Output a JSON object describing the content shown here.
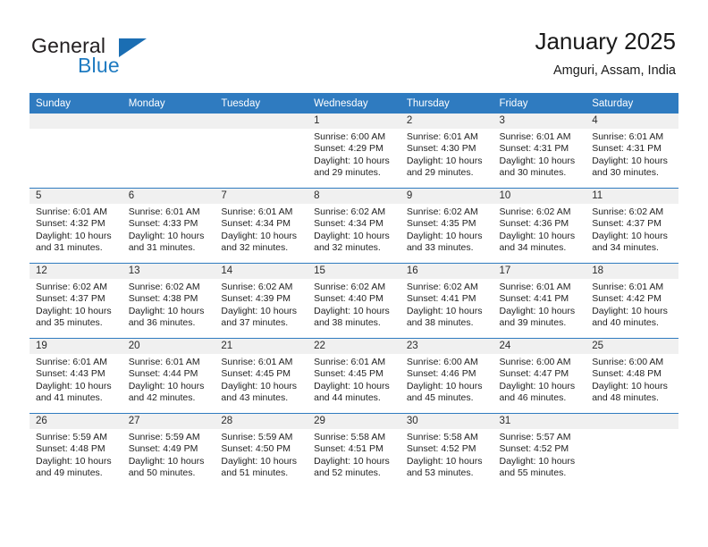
{
  "brand": {
    "name_part1": "General",
    "name_part2": "Blue",
    "triangle_color": "#1b6eb3",
    "blue_text_color": "#1f7bc1"
  },
  "header": {
    "title": "January 2025",
    "subtitle": "Amguri, Assam, India"
  },
  "theme": {
    "header_blue": "#2f7bc0",
    "daynum_band": "#f0f0f0",
    "cell_background": "#ffffff",
    "text_color": "#1f1f1f"
  },
  "weekdays": [
    "Sunday",
    "Monday",
    "Tuesday",
    "Wednesday",
    "Thursday",
    "Friday",
    "Saturday"
  ],
  "weeks": [
    [
      {
        "day": "",
        "sunrise": "",
        "sunset": "",
        "daylight_line1": "",
        "daylight_line2": "",
        "empty": true
      },
      {
        "day": "",
        "sunrise": "",
        "sunset": "",
        "daylight_line1": "",
        "daylight_line2": "",
        "empty": true
      },
      {
        "day": "",
        "sunrise": "",
        "sunset": "",
        "daylight_line1": "",
        "daylight_line2": "",
        "empty": true
      },
      {
        "day": "1",
        "sunrise": "Sunrise: 6:00 AM",
        "sunset": "Sunset: 4:29 PM",
        "daylight_line1": "Daylight: 10 hours",
        "daylight_line2": "and 29 minutes.",
        "empty": false
      },
      {
        "day": "2",
        "sunrise": "Sunrise: 6:01 AM",
        "sunset": "Sunset: 4:30 PM",
        "daylight_line1": "Daylight: 10 hours",
        "daylight_line2": "and 29 minutes.",
        "empty": false
      },
      {
        "day": "3",
        "sunrise": "Sunrise: 6:01 AM",
        "sunset": "Sunset: 4:31 PM",
        "daylight_line1": "Daylight: 10 hours",
        "daylight_line2": "and 30 minutes.",
        "empty": false
      },
      {
        "day": "4",
        "sunrise": "Sunrise: 6:01 AM",
        "sunset": "Sunset: 4:31 PM",
        "daylight_line1": "Daylight: 10 hours",
        "daylight_line2": "and 30 minutes.",
        "empty": false
      }
    ],
    [
      {
        "day": "5",
        "sunrise": "Sunrise: 6:01 AM",
        "sunset": "Sunset: 4:32 PM",
        "daylight_line1": "Daylight: 10 hours",
        "daylight_line2": "and 31 minutes.",
        "empty": false
      },
      {
        "day": "6",
        "sunrise": "Sunrise: 6:01 AM",
        "sunset": "Sunset: 4:33 PM",
        "daylight_line1": "Daylight: 10 hours",
        "daylight_line2": "and 31 minutes.",
        "empty": false
      },
      {
        "day": "7",
        "sunrise": "Sunrise: 6:01 AM",
        "sunset": "Sunset: 4:34 PM",
        "daylight_line1": "Daylight: 10 hours",
        "daylight_line2": "and 32 minutes.",
        "empty": false
      },
      {
        "day": "8",
        "sunrise": "Sunrise: 6:02 AM",
        "sunset": "Sunset: 4:34 PM",
        "daylight_line1": "Daylight: 10 hours",
        "daylight_line2": "and 32 minutes.",
        "empty": false
      },
      {
        "day": "9",
        "sunrise": "Sunrise: 6:02 AM",
        "sunset": "Sunset: 4:35 PM",
        "daylight_line1": "Daylight: 10 hours",
        "daylight_line2": "and 33 minutes.",
        "empty": false
      },
      {
        "day": "10",
        "sunrise": "Sunrise: 6:02 AM",
        "sunset": "Sunset: 4:36 PM",
        "daylight_line1": "Daylight: 10 hours",
        "daylight_line2": "and 34 minutes.",
        "empty": false
      },
      {
        "day": "11",
        "sunrise": "Sunrise: 6:02 AM",
        "sunset": "Sunset: 4:37 PM",
        "daylight_line1": "Daylight: 10 hours",
        "daylight_line2": "and 34 minutes.",
        "empty": false
      }
    ],
    [
      {
        "day": "12",
        "sunrise": "Sunrise: 6:02 AM",
        "sunset": "Sunset: 4:37 PM",
        "daylight_line1": "Daylight: 10 hours",
        "daylight_line2": "and 35 minutes.",
        "empty": false
      },
      {
        "day": "13",
        "sunrise": "Sunrise: 6:02 AM",
        "sunset": "Sunset: 4:38 PM",
        "daylight_line1": "Daylight: 10 hours",
        "daylight_line2": "and 36 minutes.",
        "empty": false
      },
      {
        "day": "14",
        "sunrise": "Sunrise: 6:02 AM",
        "sunset": "Sunset: 4:39 PM",
        "daylight_line1": "Daylight: 10 hours",
        "daylight_line2": "and 37 minutes.",
        "empty": false
      },
      {
        "day": "15",
        "sunrise": "Sunrise: 6:02 AM",
        "sunset": "Sunset: 4:40 PM",
        "daylight_line1": "Daylight: 10 hours",
        "daylight_line2": "and 38 minutes.",
        "empty": false
      },
      {
        "day": "16",
        "sunrise": "Sunrise: 6:02 AM",
        "sunset": "Sunset: 4:41 PM",
        "daylight_line1": "Daylight: 10 hours",
        "daylight_line2": "and 38 minutes.",
        "empty": false
      },
      {
        "day": "17",
        "sunrise": "Sunrise: 6:01 AM",
        "sunset": "Sunset: 4:41 PM",
        "daylight_line1": "Daylight: 10 hours",
        "daylight_line2": "and 39 minutes.",
        "empty": false
      },
      {
        "day": "18",
        "sunrise": "Sunrise: 6:01 AM",
        "sunset": "Sunset: 4:42 PM",
        "daylight_line1": "Daylight: 10 hours",
        "daylight_line2": "and 40 minutes.",
        "empty": false
      }
    ],
    [
      {
        "day": "19",
        "sunrise": "Sunrise: 6:01 AM",
        "sunset": "Sunset: 4:43 PM",
        "daylight_line1": "Daylight: 10 hours",
        "daylight_line2": "and 41 minutes.",
        "empty": false
      },
      {
        "day": "20",
        "sunrise": "Sunrise: 6:01 AM",
        "sunset": "Sunset: 4:44 PM",
        "daylight_line1": "Daylight: 10 hours",
        "daylight_line2": "and 42 minutes.",
        "empty": false
      },
      {
        "day": "21",
        "sunrise": "Sunrise: 6:01 AM",
        "sunset": "Sunset: 4:45 PM",
        "daylight_line1": "Daylight: 10 hours",
        "daylight_line2": "and 43 minutes.",
        "empty": false
      },
      {
        "day": "22",
        "sunrise": "Sunrise: 6:01 AM",
        "sunset": "Sunset: 4:45 PM",
        "daylight_line1": "Daylight: 10 hours",
        "daylight_line2": "and 44 minutes.",
        "empty": false
      },
      {
        "day": "23",
        "sunrise": "Sunrise: 6:00 AM",
        "sunset": "Sunset: 4:46 PM",
        "daylight_line1": "Daylight: 10 hours",
        "daylight_line2": "and 45 minutes.",
        "empty": false
      },
      {
        "day": "24",
        "sunrise": "Sunrise: 6:00 AM",
        "sunset": "Sunset: 4:47 PM",
        "daylight_line1": "Daylight: 10 hours",
        "daylight_line2": "and 46 minutes.",
        "empty": false
      },
      {
        "day": "25",
        "sunrise": "Sunrise: 6:00 AM",
        "sunset": "Sunset: 4:48 PM",
        "daylight_line1": "Daylight: 10 hours",
        "daylight_line2": "and 48 minutes.",
        "empty": false
      }
    ],
    [
      {
        "day": "26",
        "sunrise": "Sunrise: 5:59 AM",
        "sunset": "Sunset: 4:48 PM",
        "daylight_line1": "Daylight: 10 hours",
        "daylight_line2": "and 49 minutes.",
        "empty": false
      },
      {
        "day": "27",
        "sunrise": "Sunrise: 5:59 AM",
        "sunset": "Sunset: 4:49 PM",
        "daylight_line1": "Daylight: 10 hours",
        "daylight_line2": "and 50 minutes.",
        "empty": false
      },
      {
        "day": "28",
        "sunrise": "Sunrise: 5:59 AM",
        "sunset": "Sunset: 4:50 PM",
        "daylight_line1": "Daylight: 10 hours",
        "daylight_line2": "and 51 minutes.",
        "empty": false
      },
      {
        "day": "29",
        "sunrise": "Sunrise: 5:58 AM",
        "sunset": "Sunset: 4:51 PM",
        "daylight_line1": "Daylight: 10 hours",
        "daylight_line2": "and 52 minutes.",
        "empty": false
      },
      {
        "day": "30",
        "sunrise": "Sunrise: 5:58 AM",
        "sunset": "Sunset: 4:52 PM",
        "daylight_line1": "Daylight: 10 hours",
        "daylight_line2": "and 53 minutes.",
        "empty": false
      },
      {
        "day": "31",
        "sunrise": "Sunrise: 5:57 AM",
        "sunset": "Sunset: 4:52 PM",
        "daylight_line1": "Daylight: 10 hours",
        "daylight_line2": "and 55 minutes.",
        "empty": false
      },
      {
        "day": "",
        "sunrise": "",
        "sunset": "",
        "daylight_line1": "",
        "daylight_line2": "",
        "empty": true
      }
    ]
  ]
}
